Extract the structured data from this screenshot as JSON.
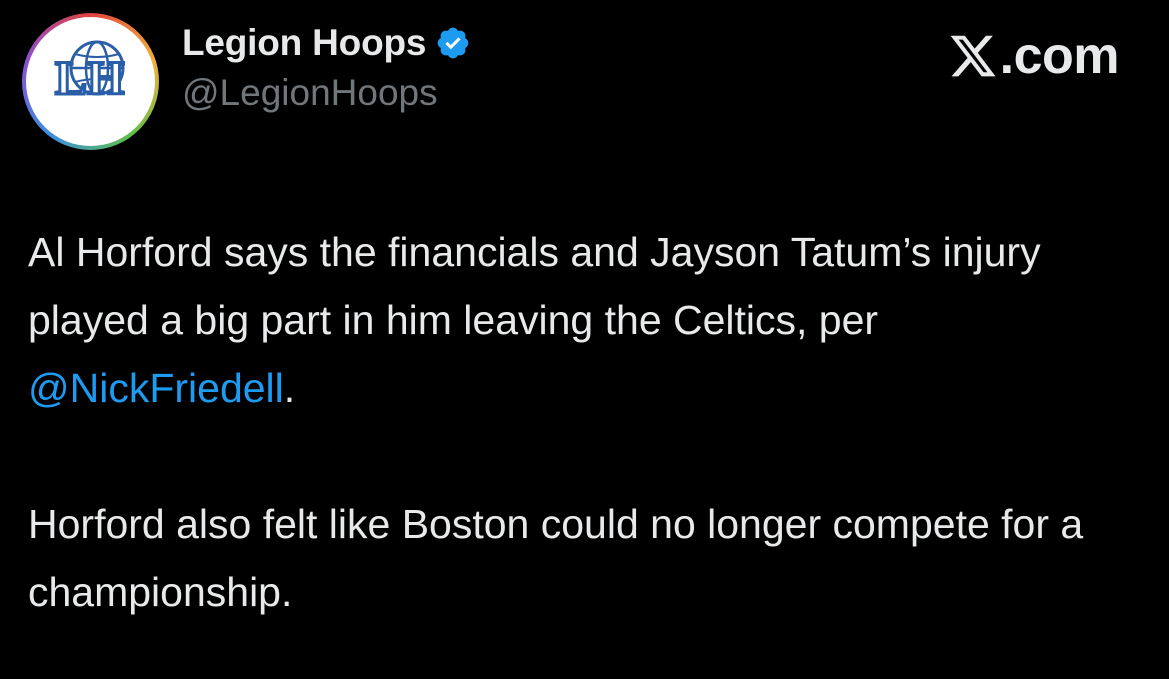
{
  "author": {
    "display_name": "Legion Hoops",
    "handle": "@LegionHoops",
    "avatar_icon": "legion-hoops-logo-icon",
    "verified_icon": "verified-badge-icon",
    "avatar_logo_text": "LH"
  },
  "branding": {
    "watermark_text": ".com",
    "watermark_icon": "x-logo-icon"
  },
  "tweet": {
    "paragraph1_before_mention": "Al Horford says the financials and Jayson Tatum’s injury played a big part in him leaving the Celtics, per ",
    "mention": "@NickFriedell",
    "paragraph1_after_mention": ".",
    "paragraph2": "Horford also felt like Boston could no longer compete for a championship."
  },
  "colors": {
    "background": "#000000",
    "text": "#e7e9ea",
    "secondary_text": "#71767b",
    "link": "#1d9bf0",
    "verified": "#1d9bf0"
  }
}
